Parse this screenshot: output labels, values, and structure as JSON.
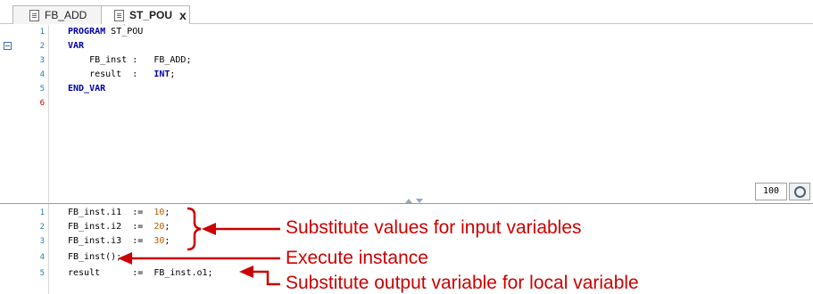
{
  "tabs": [
    {
      "label": "FB_ADD",
      "active": false
    },
    {
      "label": "ST_POU",
      "active": true,
      "close_glyph": "x"
    }
  ],
  "declaration_pane": {
    "lines": [
      {
        "number": "1",
        "keyword": "PROGRAM",
        "text": " ST_POU"
      },
      {
        "number": "2",
        "keyword": "VAR",
        "text": ""
      },
      {
        "number": "3",
        "text": "    FB_inst :   FB_ADD;"
      },
      {
        "number": "4",
        "text": "    result  :   ",
        "type_keyword": "INT",
        "suffix": ";"
      },
      {
        "number": "5",
        "keyword": "END_VAR",
        "text": ""
      },
      {
        "number": "6",
        "text": "",
        "error_marker": true
      }
    ]
  },
  "implementation_pane": {
    "lines": [
      {
        "number": "1",
        "text": "FB_inst.i1  :=  ",
        "value": "10",
        "suffix": ";"
      },
      {
        "number": "2",
        "text": "FB_inst.i2  :=  ",
        "value": "20",
        "suffix": ";"
      },
      {
        "number": "3",
        "text": "FB_inst.i3  :=  ",
        "value": "30",
        "suffix": ";"
      },
      {
        "number": "4",
        "text": "FB_inst();"
      },
      {
        "number": "5",
        "text": "result      :=  FB_inst.o1;"
      }
    ]
  },
  "zoom": {
    "value": "100",
    "icon": "zoom-icon"
  },
  "annotations": {
    "input_vars": "Substitute values for input variables",
    "execute": "Execute instance",
    "output_var": "Substitute output variable for local variable",
    "color": "#cc0000"
  },
  "colors": {
    "keyword": "#0000a8",
    "number": "#b06000",
    "line_number": "#2b7fa8"
  }
}
